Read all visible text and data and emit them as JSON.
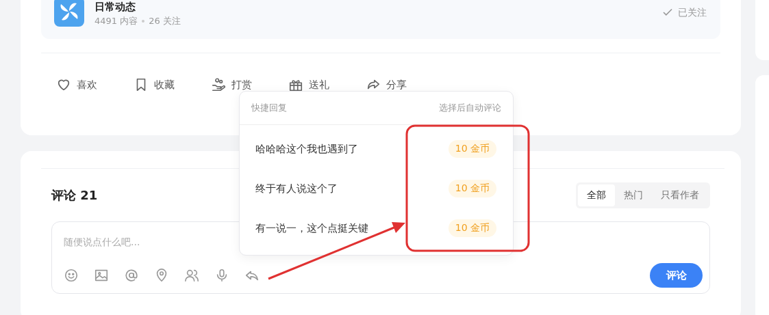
{
  "channel": {
    "name": "日常动态",
    "stats": [
      "4491 内容",
      "26 关注"
    ],
    "follow": {
      "label": "已关注",
      "followed": true
    }
  },
  "actions": [
    {
      "kind": "heart",
      "label": "喜欢"
    },
    {
      "kind": "bookmark",
      "label": "收藏"
    },
    {
      "kind": "tip",
      "label": "打赏"
    },
    {
      "kind": "gift",
      "label": "送礼"
    },
    {
      "kind": "share",
      "label": "分享"
    }
  ],
  "comments": {
    "title": "评论 21",
    "filters": [
      {
        "label": "全部",
        "selected": true
      },
      {
        "label": "热门",
        "selected": false
      },
      {
        "label": "只看作者",
        "selected": false
      }
    ],
    "input": {
      "placeholder": "随便说点什么吧..."
    },
    "tools": [
      {
        "kind": "emoji"
      },
      {
        "kind": "image"
      },
      {
        "kind": "at"
      },
      {
        "kind": "location"
      },
      {
        "kind": "people"
      },
      {
        "kind": "mic"
      },
      {
        "kind": "reply"
      }
    ],
    "submit": "评论"
  },
  "quick_reply": {
    "title": "快捷回复",
    "hint": "选择后自动评论",
    "items": [
      {
        "text": "哈哈哈这个我也遇到了",
        "price": "10 金币"
      },
      {
        "text": "终于有人说这个了",
        "price": "10 金币"
      },
      {
        "text": "有一说一，这个点挺关键",
        "price": "10 金币"
      }
    ]
  }
}
